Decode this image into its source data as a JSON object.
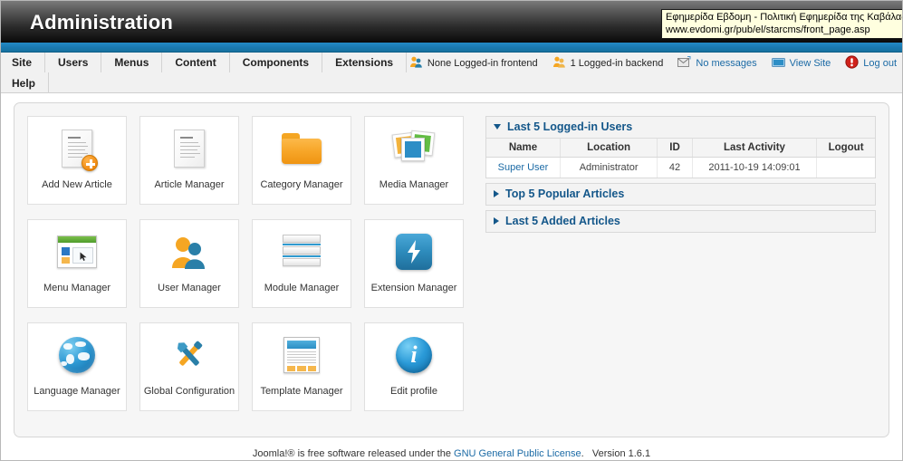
{
  "header": {
    "title": "Administration"
  },
  "tooltip": {
    "line1": "Εφημερίδα Εβδομη - Πολιτική Εφημερίδα της Καβάλας",
    "line2": "www.evdomi.gr/pub/el/starcms/front_page.asp"
  },
  "menu": {
    "row1": [
      {
        "label": "Site"
      },
      {
        "label": "Users"
      },
      {
        "label": "Menus"
      },
      {
        "label": "Content"
      },
      {
        "label": "Components"
      },
      {
        "label": "Extensions"
      }
    ],
    "row2": [
      {
        "label": "Help"
      }
    ]
  },
  "status": [
    {
      "label": "None Logged-in frontend",
      "icon": "users-frontend-icon",
      "link": false
    },
    {
      "label": "1 Logged-in backend",
      "icon": "users-backend-icon",
      "link": false
    },
    {
      "label": "No messages",
      "icon": "mail-icon",
      "link": true
    },
    {
      "label": "View Site",
      "icon": "monitor-icon",
      "link": true
    },
    {
      "label": "Log out",
      "icon": "logout-icon",
      "link": true
    }
  ],
  "quick_icons": [
    {
      "label": "Add New Article",
      "icon": "new-article-icon"
    },
    {
      "label": "Article Manager",
      "icon": "article-icon"
    },
    {
      "label": "Category Manager",
      "icon": "folder-icon"
    },
    {
      "label": "Media Manager",
      "icon": "photos-icon"
    },
    {
      "label": "Menu Manager",
      "icon": "window-menu-icon"
    },
    {
      "label": "User Manager",
      "icon": "people-icon"
    },
    {
      "label": "Module Manager",
      "icon": "stack-icon"
    },
    {
      "label": "Extension Manager",
      "icon": "plug-bolt-icon"
    },
    {
      "label": "Language Manager",
      "icon": "globe-icon"
    },
    {
      "label": "Global Configuration",
      "icon": "tools-icon"
    },
    {
      "label": "Template Manager",
      "icon": "template-icon"
    },
    {
      "label": "Edit profile",
      "icon": "info-icon"
    }
  ],
  "modules": [
    {
      "title": "Last 5 Logged-in Users",
      "expanded": true,
      "columns": [
        "Name",
        "Location",
        "ID",
        "Last Activity",
        "Logout"
      ],
      "rows": [
        [
          "Super User",
          "Administrator",
          "42",
          "2011-10-19 14:09:01",
          ""
        ]
      ]
    },
    {
      "title": "Top 5 Popular Articles",
      "expanded": false
    },
    {
      "title": "Last 5 Added Articles",
      "expanded": false
    }
  ],
  "footer": {
    "pre": "Joomla!® is free software released under the ",
    "link": "GNU General Public License",
    "post": ".",
    "version": "Version 1.6.1"
  },
  "colors": {
    "accent_blue": "#1a79b0",
    "link_blue": "#1b6aa5",
    "module_title": "#14578a",
    "tooltip_bg": "#ffffdf"
  }
}
